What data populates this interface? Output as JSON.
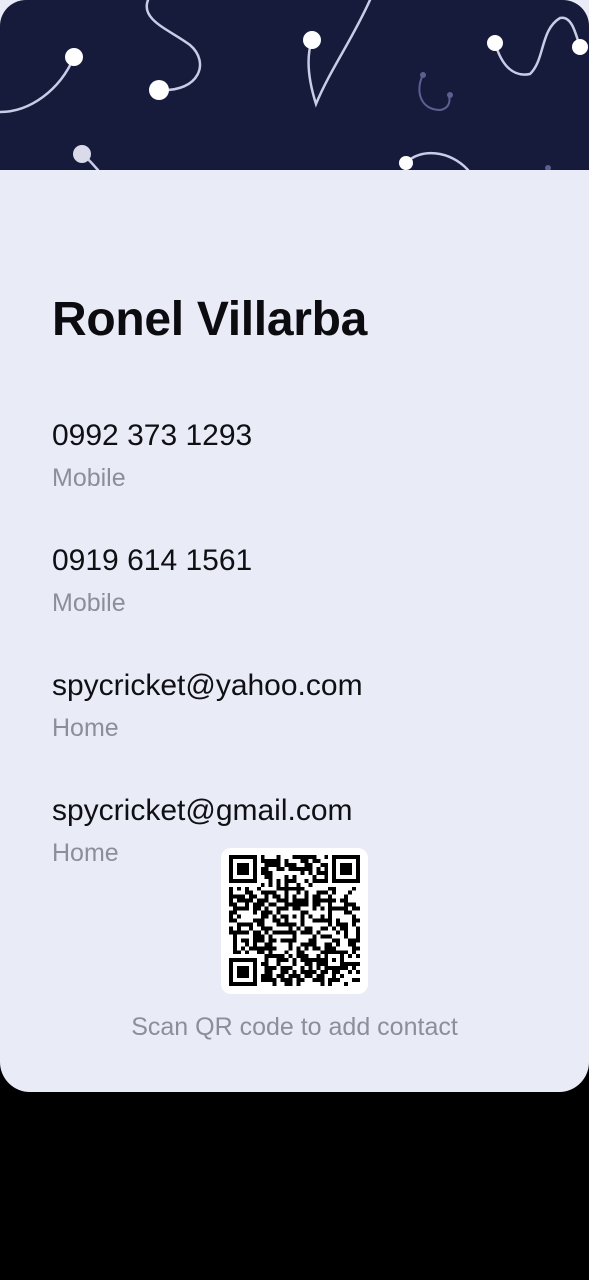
{
  "contact": {
    "name": "Ronel Villarba",
    "entries": [
      {
        "value": "0992 373 1293",
        "label": "Mobile",
        "type": "phone"
      },
      {
        "value": "0919 614 1561",
        "label": "Mobile",
        "type": "phone"
      },
      {
        "value": "spycricket@yahoo.com",
        "label": "Home",
        "type": "email"
      },
      {
        "value": "spycricket@gmail.com",
        "label": "Home",
        "type": "email"
      }
    ]
  },
  "qr": {
    "caption": "Scan QR code to add contact"
  },
  "colors": {
    "header_bg": "#161A3B",
    "card_bg": "#E9ECF7",
    "label_gray": "#8C8F99",
    "screen_bg": "#000000"
  }
}
